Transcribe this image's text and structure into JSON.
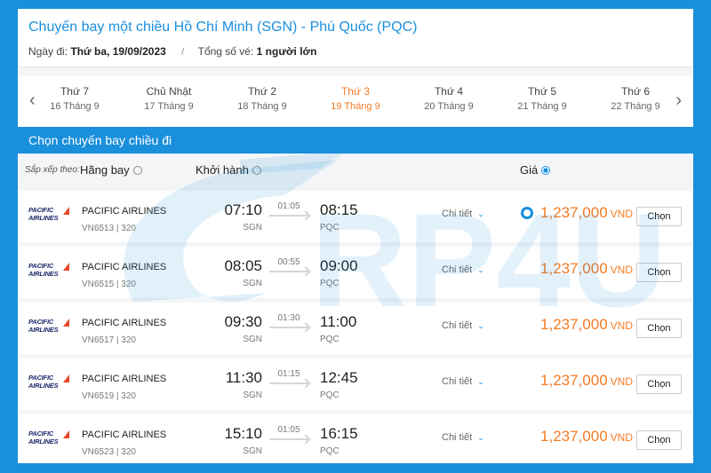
{
  "header": {
    "title": "Chuyến bay một chiều Hồ Chí Minh (SGN) - Phú Quốc (PQC)",
    "date_label": "Ngày đi:",
    "date_value": "Thứ ba, 19/09/2023",
    "separator": "/",
    "tickets_label": "Tổng số vé:",
    "tickets_value": "1 người lớn"
  },
  "date_nav": {
    "prev": "‹",
    "next": "›",
    "days": [
      {
        "weekday": "Thứ 7",
        "date": "16 Tháng 9"
      },
      {
        "weekday": "Chủ Nhật",
        "date": "17 Tháng 9"
      },
      {
        "weekday": "Thứ 2",
        "date": "18 Tháng 9"
      },
      {
        "weekday": "Thứ 3",
        "date": "19 Tháng 9"
      },
      {
        "weekday": "Thứ 4",
        "date": "20 Tháng 9"
      },
      {
        "weekday": "Thứ 5",
        "date": "21 Tháng 9"
      },
      {
        "weekday": "Thứ 6",
        "date": "22 Tháng 9"
      }
    ],
    "active_index": 3
  },
  "section_title": "Chọn chuyến bay chiều đi",
  "sort": {
    "label": "Sắp xếp theo:",
    "airline": "Hãng bay",
    "departure": "Khởi hành",
    "price": "Giá",
    "selected": "price"
  },
  "logo": {
    "line1": "PACIFIC",
    "line2": "AIRLINES"
  },
  "colors": {
    "accent": "#1a8fdc",
    "price": "#f37a24",
    "logo": "#1b2a6b"
  },
  "flights": [
    {
      "airline": "PACIFIC AIRLINES",
      "code": "VN6513 | 320",
      "dep_time": "07:10",
      "dep_airport": "SGN",
      "duration": "01:05",
      "arr_time": "08:15",
      "arr_airport": "PQC",
      "detail": "Chi tiết",
      "price": "1,237,000",
      "currency": "VND",
      "action": "Chọn"
    },
    {
      "airline": "PACIFIC AIRLINES",
      "code": "VN6515 | 320",
      "dep_time": "08:05",
      "dep_airport": "SGN",
      "duration": "00:55",
      "arr_time": "09:00",
      "arr_airport": "PQC",
      "detail": "Chi tiết",
      "price": "1,237,000",
      "currency": "VND",
      "action": "Chọn"
    },
    {
      "airline": "PACIFIC AIRLINES",
      "code": "VN6517 | 320",
      "dep_time": "09:30",
      "dep_airport": "SGN",
      "duration": "01:30",
      "arr_time": "11:00",
      "arr_airport": "PQC",
      "detail": "Chi tiết",
      "price": "1,237,000",
      "currency": "VND",
      "action": "Chọn"
    },
    {
      "airline": "PACIFIC AIRLINES",
      "code": "VN6519 | 320",
      "dep_time": "11:30",
      "dep_airport": "SGN",
      "duration": "01:15",
      "arr_time": "12:45",
      "arr_airport": "PQC",
      "detail": "Chi tiết",
      "price": "1,237,000",
      "currency": "VND",
      "action": "Chọn"
    },
    {
      "airline": "PACIFIC AIRLINES",
      "code": "VN6523 | 320",
      "dep_time": "15:10",
      "dep_airport": "SGN",
      "duration": "01:05",
      "arr_time": "16:15",
      "arr_airport": "PQC",
      "detail": "Chi tiết",
      "price": "1,237,000",
      "currency": "VND",
      "action": "Chọn"
    }
  ],
  "watermark": {
    "text": "RP4U"
  }
}
